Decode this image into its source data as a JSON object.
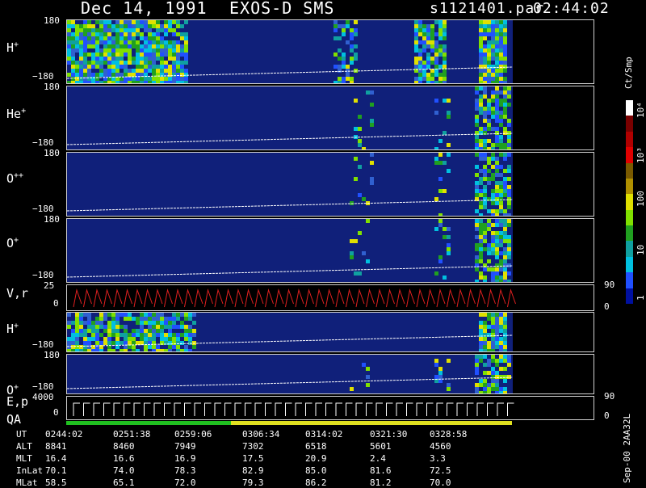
{
  "header": {
    "date": "Dec 14, 1991",
    "instrument": "EXOS-D SMS",
    "file": "s1121401.par",
    "time": "02:44:02"
  },
  "colorbar": {
    "unit": "Ct/Smp",
    "labels": [
      "10⁴",
      "10³",
      "100",
      "10",
      "1"
    ],
    "colors": [
      "#ffffff",
      "#7a0000",
      "#b00000",
      "#e00000",
      "#7a5a00",
      "#b09000",
      "#e0e000",
      "#80e000",
      "#20a020",
      "#10a0a0",
      "#00c0e0",
      "#2050ff",
      "#0010a0"
    ]
  },
  "panels": [
    {
      "label": "H",
      "sup": "+",
      "ytop": "180",
      "ybot": "−180",
      "kind": "pitch"
    },
    {
      "label": "He",
      "sup": "+",
      "ytop": "180",
      "ybot": "−180",
      "kind": "pitch"
    },
    {
      "label": "O",
      "sup": "++",
      "ytop": "180",
      "ybot": "−180",
      "kind": "pitch"
    },
    {
      "label": "O",
      "sup": "+",
      "ytop": "180",
      "ybot": "−180",
      "kind": "pitch"
    },
    {
      "label": "V,r",
      "sup": "",
      "ytop": "25",
      "ybot": "0",
      "right_top": "90",
      "right_bot": "0",
      "kind": "line"
    },
    {
      "label": "H",
      "sup": "+",
      "ytop": "",
      "ybot": "−180",
      "kind": "pitch"
    },
    {
      "label": "O",
      "sup": "+",
      "ytop": "180",
      "ybot": "−180",
      "kind": "pitch"
    },
    {
      "label": "E,p",
      "label2": "QA",
      "sup": "",
      "ytop": "4000",
      "ybot": "0",
      "right_top": "90",
      "right_bot": "0",
      "kind": "ep"
    }
  ],
  "qa_bar": {
    "colors": [
      "#20c020",
      "#e0e020"
    ],
    "split_fraction": 0.37
  },
  "table": {
    "row_labels": [
      "UT",
      "ALT",
      "MLT",
      "InLat",
      "MLat"
    ],
    "columns": [
      [
        "0244:02",
        "8841",
        "16.4",
        "70.1",
        "58.5"
      ],
      [
        "0251:38",
        "8460",
        "16.6",
        "74.0",
        "65.1"
      ],
      [
        "0259:06",
        "7949",
        "16.9",
        "78.3",
        "72.0"
      ],
      [
        "0306:34",
        "7302",
        "17.5",
        "82.9",
        "79.3"
      ],
      [
        "0314:02",
        "6518",
        "20.9",
        "85.0",
        "86.2"
      ],
      [
        "0321:30",
        "5601",
        "2.4",
        "81.6",
        "81.2"
      ],
      [
        "0328:58",
        "4560",
        "3.3",
        "72.5",
        "70.0"
      ]
    ]
  },
  "footer": "Sep-00 2AA32L",
  "chart_data": {
    "type": "heatmap",
    "title": "Dec 14, 1991   EXOS-D SMS",
    "x": [
      "0244:02",
      "0251:38",
      "0259:06",
      "0306:34",
      "0314:02",
      "0321:30",
      "0328:58"
    ],
    "series": [
      {
        "name": "H+",
        "ylim": [
          -180,
          180
        ]
      },
      {
        "name": "He+",
        "ylim": [
          -180,
          180
        ]
      },
      {
        "name": "O++",
        "ylim": [
          -180,
          180
        ]
      },
      {
        "name": "O+",
        "ylim": [
          -180,
          180
        ]
      },
      {
        "name": "V,r",
        "ylim": [
          0,
          25
        ]
      },
      {
        "name": "H+",
        "ylim": [
          -180,
          180
        ]
      },
      {
        "name": "O+",
        "ylim": [
          -180,
          180
        ]
      },
      {
        "name": "E,p",
        "ylim": [
          0,
          4000
        ]
      }
    ],
    "colorscale_ticks": [
      "1",
      "10",
      "100",
      "10³",
      "10⁴"
    ]
  }
}
